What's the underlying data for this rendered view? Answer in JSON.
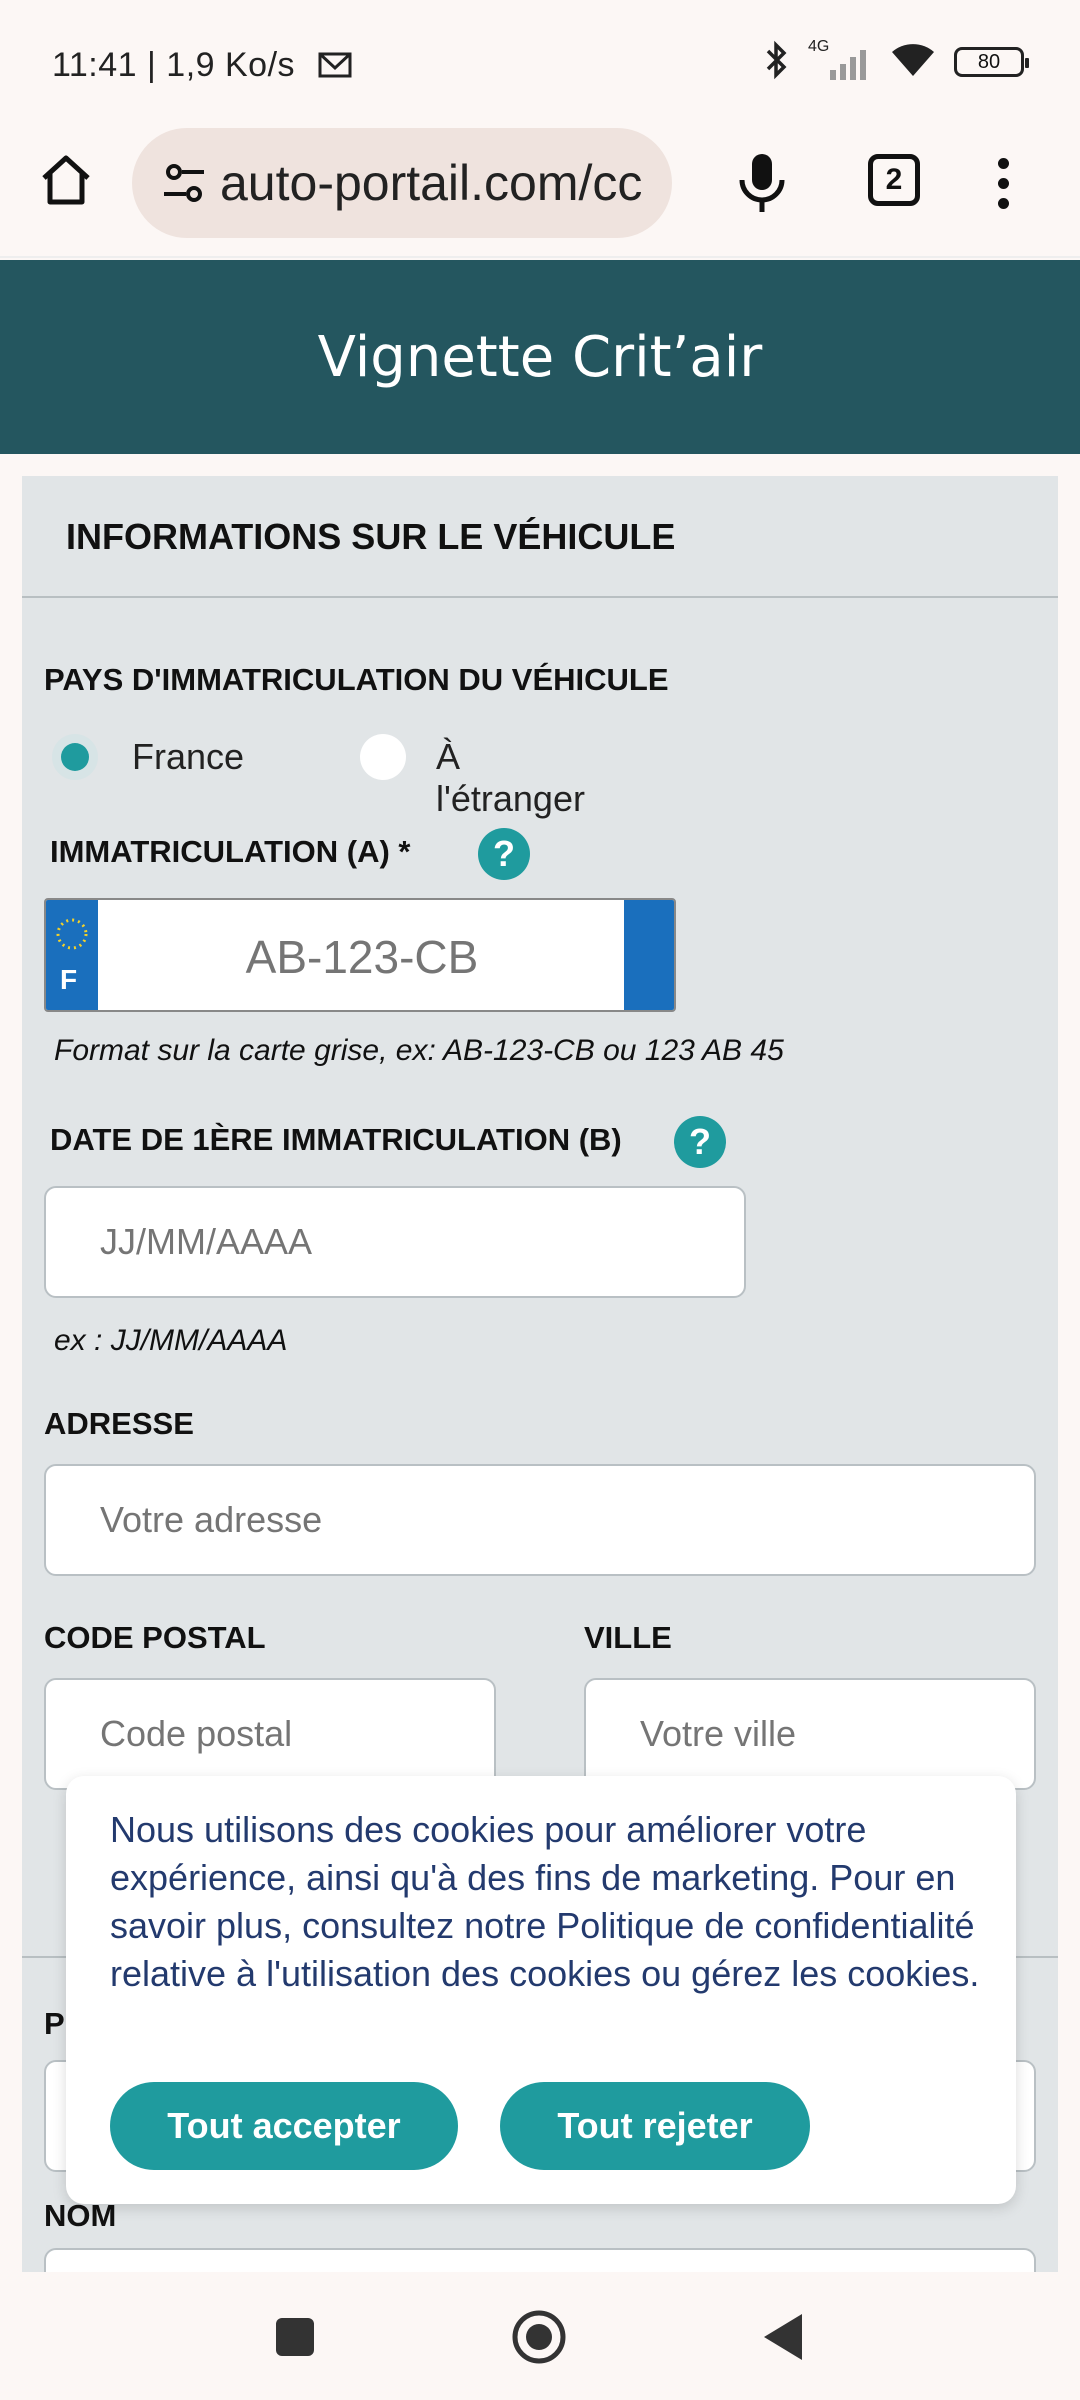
{
  "status_bar": {
    "time": "11:41 | 1,9 Ko/s",
    "network": "4G",
    "battery": "80"
  },
  "browser": {
    "url": "auto-portail.com/cc",
    "tab_count": "2"
  },
  "header": {
    "title": "Vignette Crit’air"
  },
  "form": {
    "section_title": "INFORMATIONS SUR LE VÉHICULE",
    "country_label": "PAYS D'IMMATRICULATION DU VÉHICULE",
    "country_options": [
      "France",
      "À l'étranger"
    ],
    "selected_country": "France",
    "registration_label": "IMMATRICULATION (A) *",
    "registration_placeholder": "AB-123-CB",
    "plate_country_code": "F",
    "registration_hint": "Format sur la carte grise, ex: AB-123-CB ou 123 AB 45",
    "first_registration_label": "DATE DE 1ÈRE IMMATRICULATION (B)",
    "first_registration_placeholder": "JJ/MM/AAAA",
    "first_registration_hint": "ex : JJ/MM/AAAA",
    "address_label": "ADRESSE",
    "address_placeholder": "Votre adresse",
    "postal_label": "CODE POSTAL",
    "postal_placeholder": "Code postal",
    "city_label": "VILLE",
    "city_placeholder": "Votre ville",
    "partial_label": "P",
    "name_label": "NOM",
    "help_glyph": "?"
  },
  "cookie_banner": {
    "text": "Nous utilisons des cookies pour améliorer votre expérience, ainsi qu'à des fins de marketing. Pour en savoir plus, consultez notre Politique de confidentialité relative à l'utilisation des cookies ou gérez les cookies.",
    "accept_label": "Tout accepter",
    "reject_label": "Tout rejeter"
  },
  "colors": {
    "header_bg": "#24565f",
    "accent": "#1f9b9e",
    "plate_blue": "#1a6fbd"
  }
}
